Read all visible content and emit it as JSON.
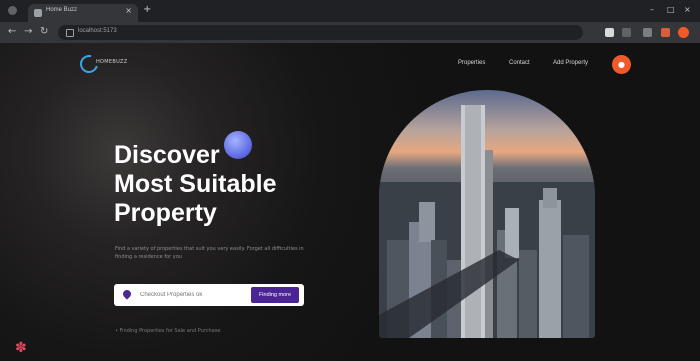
{
  "browser": {
    "tab_title": "Home Buzz",
    "tab_close": "×",
    "new_tab": "+",
    "url": "localhost:5173",
    "nav": {
      "back": "←",
      "forward": "→",
      "reload": "↻"
    },
    "window": {
      "minimize": "–",
      "maximize": "□",
      "close": "×"
    },
    "profile_color": "#f05a28"
  },
  "site": {
    "logo_text": "HOMEBUZZ",
    "nav_links": [
      "Properties",
      "Contact",
      "Add Property"
    ],
    "nav_cta_icon": "user-icon",
    "nav_cta_symbol": "●",
    "hero": {
      "title_lines": [
        "Discover",
        "Most Suitable",
        "Property"
      ],
      "description": "Find a variety of properties that suit you very easily. Forget all difficulties in finding a residence for you",
      "search_placeholder": "Checkout Properties ok",
      "search_button": "Finding more",
      "footnote": "• Finding Properties for Sale and Purchase"
    },
    "accent_color": "#4b2596",
    "cta_color": "#f0592a",
    "corner_icon": "✽"
  }
}
